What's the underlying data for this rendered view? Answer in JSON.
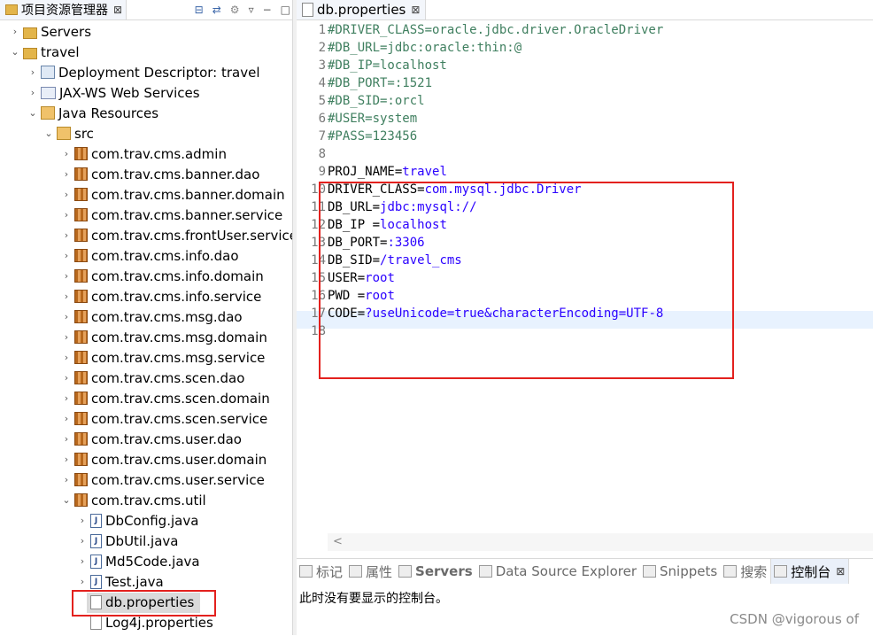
{
  "explorer": {
    "tab_title": "项目资源管理器",
    "tab_close": "⊠",
    "tree": [
      {
        "label": "Servers",
        "arrow": "›",
        "icon": "folder"
      },
      {
        "label": "travel",
        "arrow": "⌄",
        "icon": "project"
      },
      {
        "label": "Deployment Descriptor: travel",
        "arrow": "›",
        "icon": "dd"
      },
      {
        "label": "JAX-WS Web Services",
        "arrow": "›",
        "icon": "ws"
      },
      {
        "label": "Java Resources",
        "arrow": "⌄",
        "icon": "jr"
      },
      {
        "label": "src",
        "arrow": "⌄",
        "icon": "src"
      },
      {
        "label": "com.trav.cms.admin",
        "arrow": "›",
        "icon": "pkg"
      },
      {
        "label": "com.trav.cms.banner.dao",
        "arrow": "›",
        "icon": "pkg"
      },
      {
        "label": "com.trav.cms.banner.domain",
        "arrow": "›",
        "icon": "pkg"
      },
      {
        "label": "com.trav.cms.banner.service",
        "arrow": "›",
        "icon": "pkg"
      },
      {
        "label": "com.trav.cms.frontUser.service",
        "arrow": "›",
        "icon": "pkgsvc"
      },
      {
        "label": "com.trav.cms.info.dao",
        "arrow": "›",
        "icon": "pkg"
      },
      {
        "label": "com.trav.cms.info.domain",
        "arrow": "›",
        "icon": "pkg"
      },
      {
        "label": "com.trav.cms.info.service",
        "arrow": "›",
        "icon": "pkg"
      },
      {
        "label": "com.trav.cms.msg.dao",
        "arrow": "›",
        "icon": "pkgsvc"
      },
      {
        "label": "com.trav.cms.msg.domain",
        "arrow": "›",
        "icon": "pkg"
      },
      {
        "label": "com.trav.cms.msg.service",
        "arrow": "›",
        "icon": "pkgsvc"
      },
      {
        "label": "com.trav.cms.scen.dao",
        "arrow": "›",
        "icon": "pkg"
      },
      {
        "label": "com.trav.cms.scen.domain",
        "arrow": "›",
        "icon": "pkg"
      },
      {
        "label": "com.trav.cms.scen.service",
        "arrow": "›",
        "icon": "pkg"
      },
      {
        "label": "com.trav.cms.user.dao",
        "arrow": "›",
        "icon": "pkg"
      },
      {
        "label": "com.trav.cms.user.domain",
        "arrow": "›",
        "icon": "pkg"
      },
      {
        "label": "com.trav.cms.user.service",
        "arrow": "›",
        "icon": "pkgsvc"
      },
      {
        "label": "com.trav.cms.util",
        "arrow": "⌄",
        "icon": "pkg"
      },
      {
        "label": "DbConfig.java",
        "arrow": "›",
        "icon": "java"
      },
      {
        "label": "DbUtil.java",
        "arrow": "›",
        "icon": "java"
      },
      {
        "label": "Md5Code.java",
        "arrow": "›",
        "icon": "java"
      },
      {
        "label": "Test.java",
        "arrow": "›",
        "icon": "java"
      },
      {
        "label": "db.properties",
        "arrow": "",
        "icon": "file"
      },
      {
        "label": "Log4j.properties",
        "arrow": "",
        "icon": "file"
      }
    ]
  },
  "editor": {
    "tab_title": "db.properties",
    "tab_close": "⊠",
    "lines": [
      {
        "n": "1",
        "key": "#DRIVER_CLASS=oracle.jdbc.driver.OracleDriver",
        "val": "",
        "comment": true
      },
      {
        "n": "2",
        "key": "#DB_URL=jdbc:oracle:thin:@",
        "val": "",
        "comment": true
      },
      {
        "n": "3",
        "key": "#DB_IP=localhost",
        "val": "",
        "comment": true
      },
      {
        "n": "4",
        "key": "#DB_PORT=:1521",
        "val": "",
        "comment": true
      },
      {
        "n": "5",
        "key": "#DB_SID=:orcl",
        "val": "",
        "comment": true
      },
      {
        "n": "6",
        "key": "#USER=system",
        "val": "",
        "comment": true
      },
      {
        "n": "7",
        "key": "#PASS=123456",
        "val": "",
        "comment": true
      },
      {
        "n": "8",
        "key": "",
        "val": "",
        "comment": false
      },
      {
        "n": "9",
        "key": "PROJ_NAME=",
        "val": "travel",
        "comment": false
      },
      {
        "n": "10",
        "key": "DRIVER_CLASS=",
        "val": "com.mysql.jdbc.Driver",
        "comment": false
      },
      {
        "n": "11",
        "key": "DB_URL=",
        "val": "jdbc:mysql://",
        "comment": false
      },
      {
        "n": "12",
        "key": "DB_IP =",
        "val": "localhost",
        "comment": false
      },
      {
        "n": "13",
        "key": "DB_PORT=",
        "val": ":3306",
        "comment": false
      },
      {
        "n": "14",
        "key": "DB_SID=",
        "val": "/travel_cms",
        "comment": false
      },
      {
        "n": "15",
        "key": "USER=",
        "val": "root",
        "comment": false
      },
      {
        "n": "16",
        "key": "PWD =",
        "val": "root",
        "comment": false
      },
      {
        "n": "17",
        "key": "CODE=",
        "val": "?useUnicode=true&characterEncoding=UTF-8",
        "comment": false
      },
      {
        "n": "18",
        "key": "",
        "val": "",
        "comment": false
      }
    ],
    "scroll_left": "<"
  },
  "views": {
    "tabs": [
      {
        "label": "标记",
        "active": false,
        "bold": false
      },
      {
        "label": "属性",
        "active": false,
        "bold": false
      },
      {
        "label": "Servers",
        "active": false,
        "bold": true
      },
      {
        "label": "Data Source Explorer",
        "active": false,
        "bold": false
      },
      {
        "label": "Snippets",
        "active": false,
        "bold": false
      },
      {
        "label": "搜索",
        "active": false,
        "bold": false
      },
      {
        "label": "控制台",
        "active": true,
        "bold": false
      }
    ],
    "active_close": "⊠",
    "console_message": "此时没有要显示的控制台。"
  },
  "watermark": "CSDN @vigorous of",
  "colors": {
    "highlight_box": "#e3211e",
    "comment": "#3f7f5f",
    "value": "#2a00ff"
  }
}
